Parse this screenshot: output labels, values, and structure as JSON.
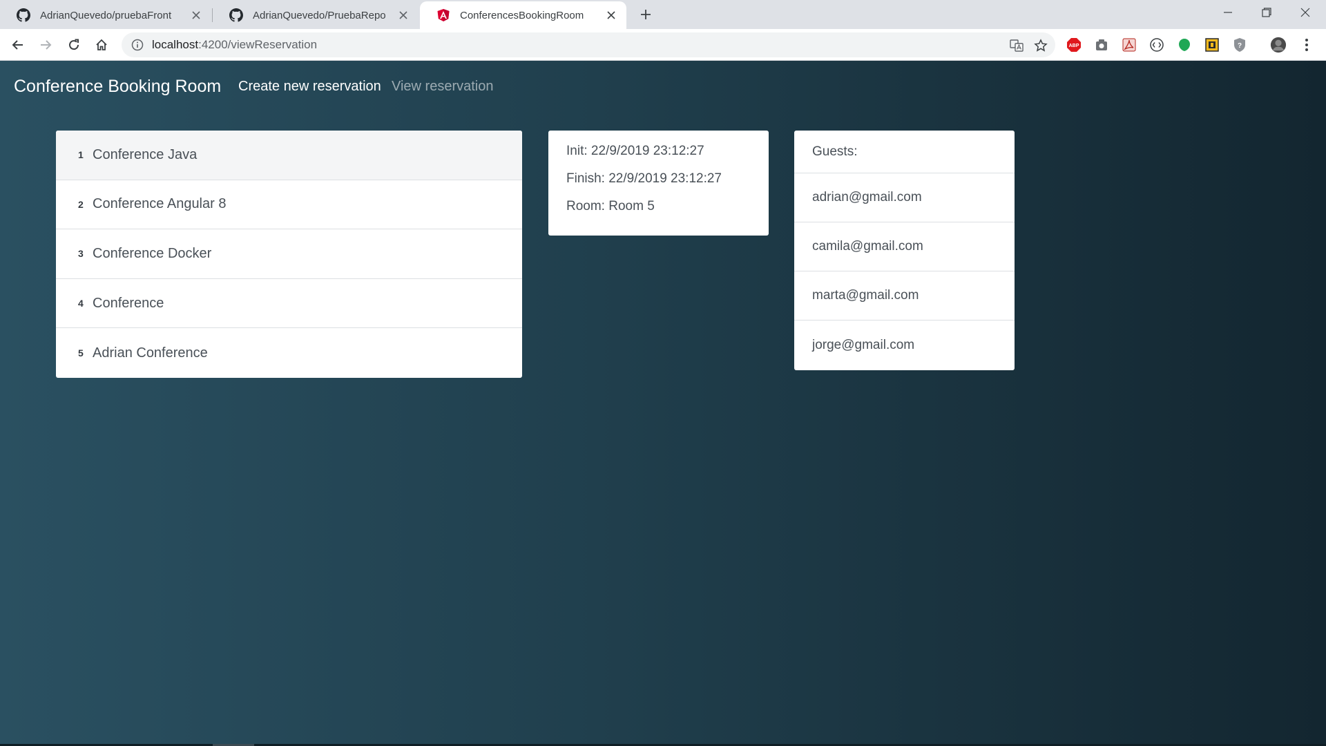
{
  "browser": {
    "tabs": [
      {
        "title": "AdrianQuevedo/pruebaFront",
        "icon": "github-icon",
        "active": false
      },
      {
        "title": "AdrianQuevedo/PruebaRepo",
        "icon": "github-icon",
        "active": false
      },
      {
        "title": "ConferencesBookingRoom",
        "icon": "angular-icon",
        "active": true
      }
    ],
    "url_host": "localhost",
    "url_path": ":4200/viewReservation"
  },
  "navbar": {
    "brand": "Conference Booking Room",
    "links": [
      "Create new reservation",
      "View reservation"
    ]
  },
  "conferences": [
    {
      "num": "1",
      "name": "Conference Java"
    },
    {
      "num": "2",
      "name": "Conference Angular 8"
    },
    {
      "num": "3",
      "name": "Conference Docker"
    },
    {
      "num": "4",
      "name": "Conference"
    },
    {
      "num": "5",
      "name": "Adrian Conference"
    }
  ],
  "details": {
    "init": "Init: 22/9/2019 23:12:27",
    "finish": "Finish: 22/9/2019 23:12:27",
    "room": "Room: Room 5"
  },
  "guests": {
    "heading": "Guests:",
    "emails": [
      "adrian@gmail.com",
      "camila@gmail.com",
      "marta@gmail.com",
      "jorge@gmail.com"
    ]
  },
  "colors": {
    "gradient_start": "#2a5061",
    "gradient_end": "#132630",
    "card_bg": "#ffffff",
    "text": "#495057"
  }
}
